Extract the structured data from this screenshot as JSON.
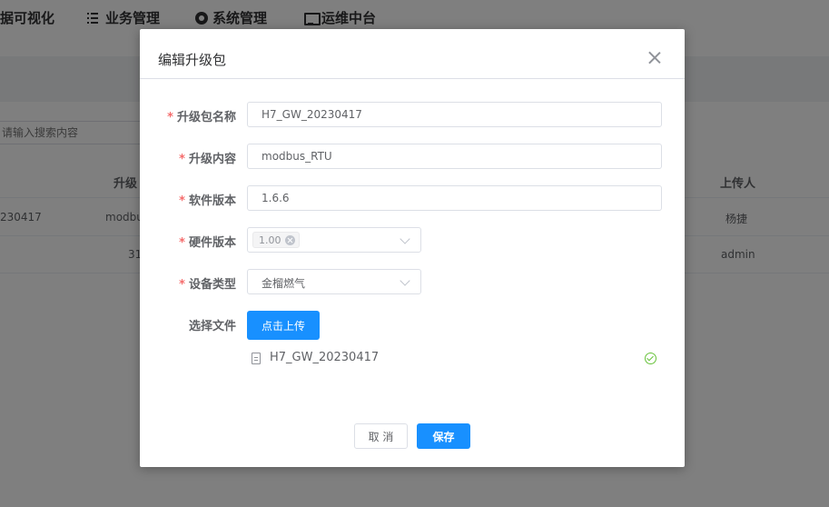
{
  "topnav": {
    "items": [
      {
        "label": "数据可视化",
        "icon": "none"
      },
      {
        "label": "业务管理",
        "icon": "list-icon"
      },
      {
        "label": "系统管理",
        "icon": "gear-icon"
      },
      {
        "label": "运维中台",
        "icon": "monitor-icon"
      }
    ]
  },
  "search": {
    "placeholder": "请输入搜索内容"
  },
  "table": {
    "headers": [
      "升级",
      "上传人"
    ],
    "rows": [
      {
        "name": "230417",
        "content": "modbu",
        "uploader": "杨捷"
      },
      {
        "name": "",
        "content": "31",
        "uploader": "admin"
      }
    ]
  },
  "dialog": {
    "title": "编辑升级包",
    "fields": {
      "name": {
        "label": "升级包名称",
        "value": "H7_GW_20230417"
      },
      "content": {
        "label": "升级内容",
        "value": "modbus_RTU"
      },
      "software": {
        "label": "软件版本",
        "value": "1.6.6"
      },
      "hardware": {
        "label": "硬件版本",
        "tag": "1.00"
      },
      "device": {
        "label": "设备类型",
        "value": "金榴燃气"
      },
      "file": {
        "label": "选择文件",
        "button": "点击上传",
        "filename": "H7_GW_20230417"
      }
    },
    "cancel_label": "取 消",
    "save_label": "保存"
  }
}
